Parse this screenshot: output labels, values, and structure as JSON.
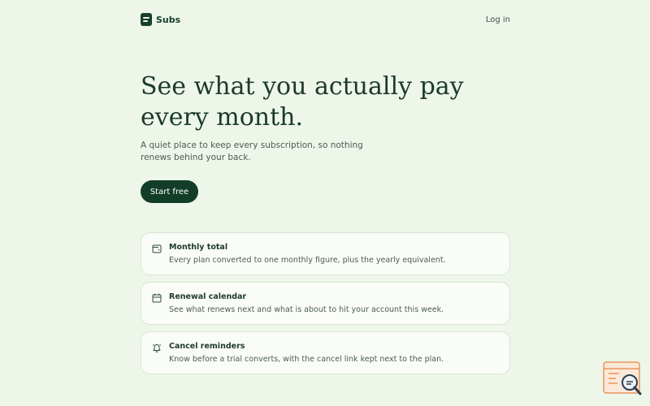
{
  "nav": {
    "brand": "Subs",
    "login": "Log in"
  },
  "hero": {
    "title_line1": "See what you actually pay",
    "title_line2": "every month.",
    "subtitle": "A quiet place to keep every subscription, so nothing renews behind your back.",
    "cta": "Start free"
  },
  "features": [
    {
      "icon": "wallet-icon",
      "title": "Monthly total",
      "desc": "Every plan converted to one monthly figure, plus the yearly equivalent."
    },
    {
      "icon": "calendar-icon",
      "title": "Renewal calendar",
      "desc": "See what renews next and what is about to hit your account this week."
    },
    {
      "icon": "bell-icon",
      "title": "Cancel reminders",
      "desc": "Know before a trial converts, with the cancel link kept next to the plan."
    }
  ],
  "colors": {
    "background": "#eef6ea",
    "brand": "#17402c",
    "cta": "#123d28",
    "card": "#fafcf7"
  }
}
